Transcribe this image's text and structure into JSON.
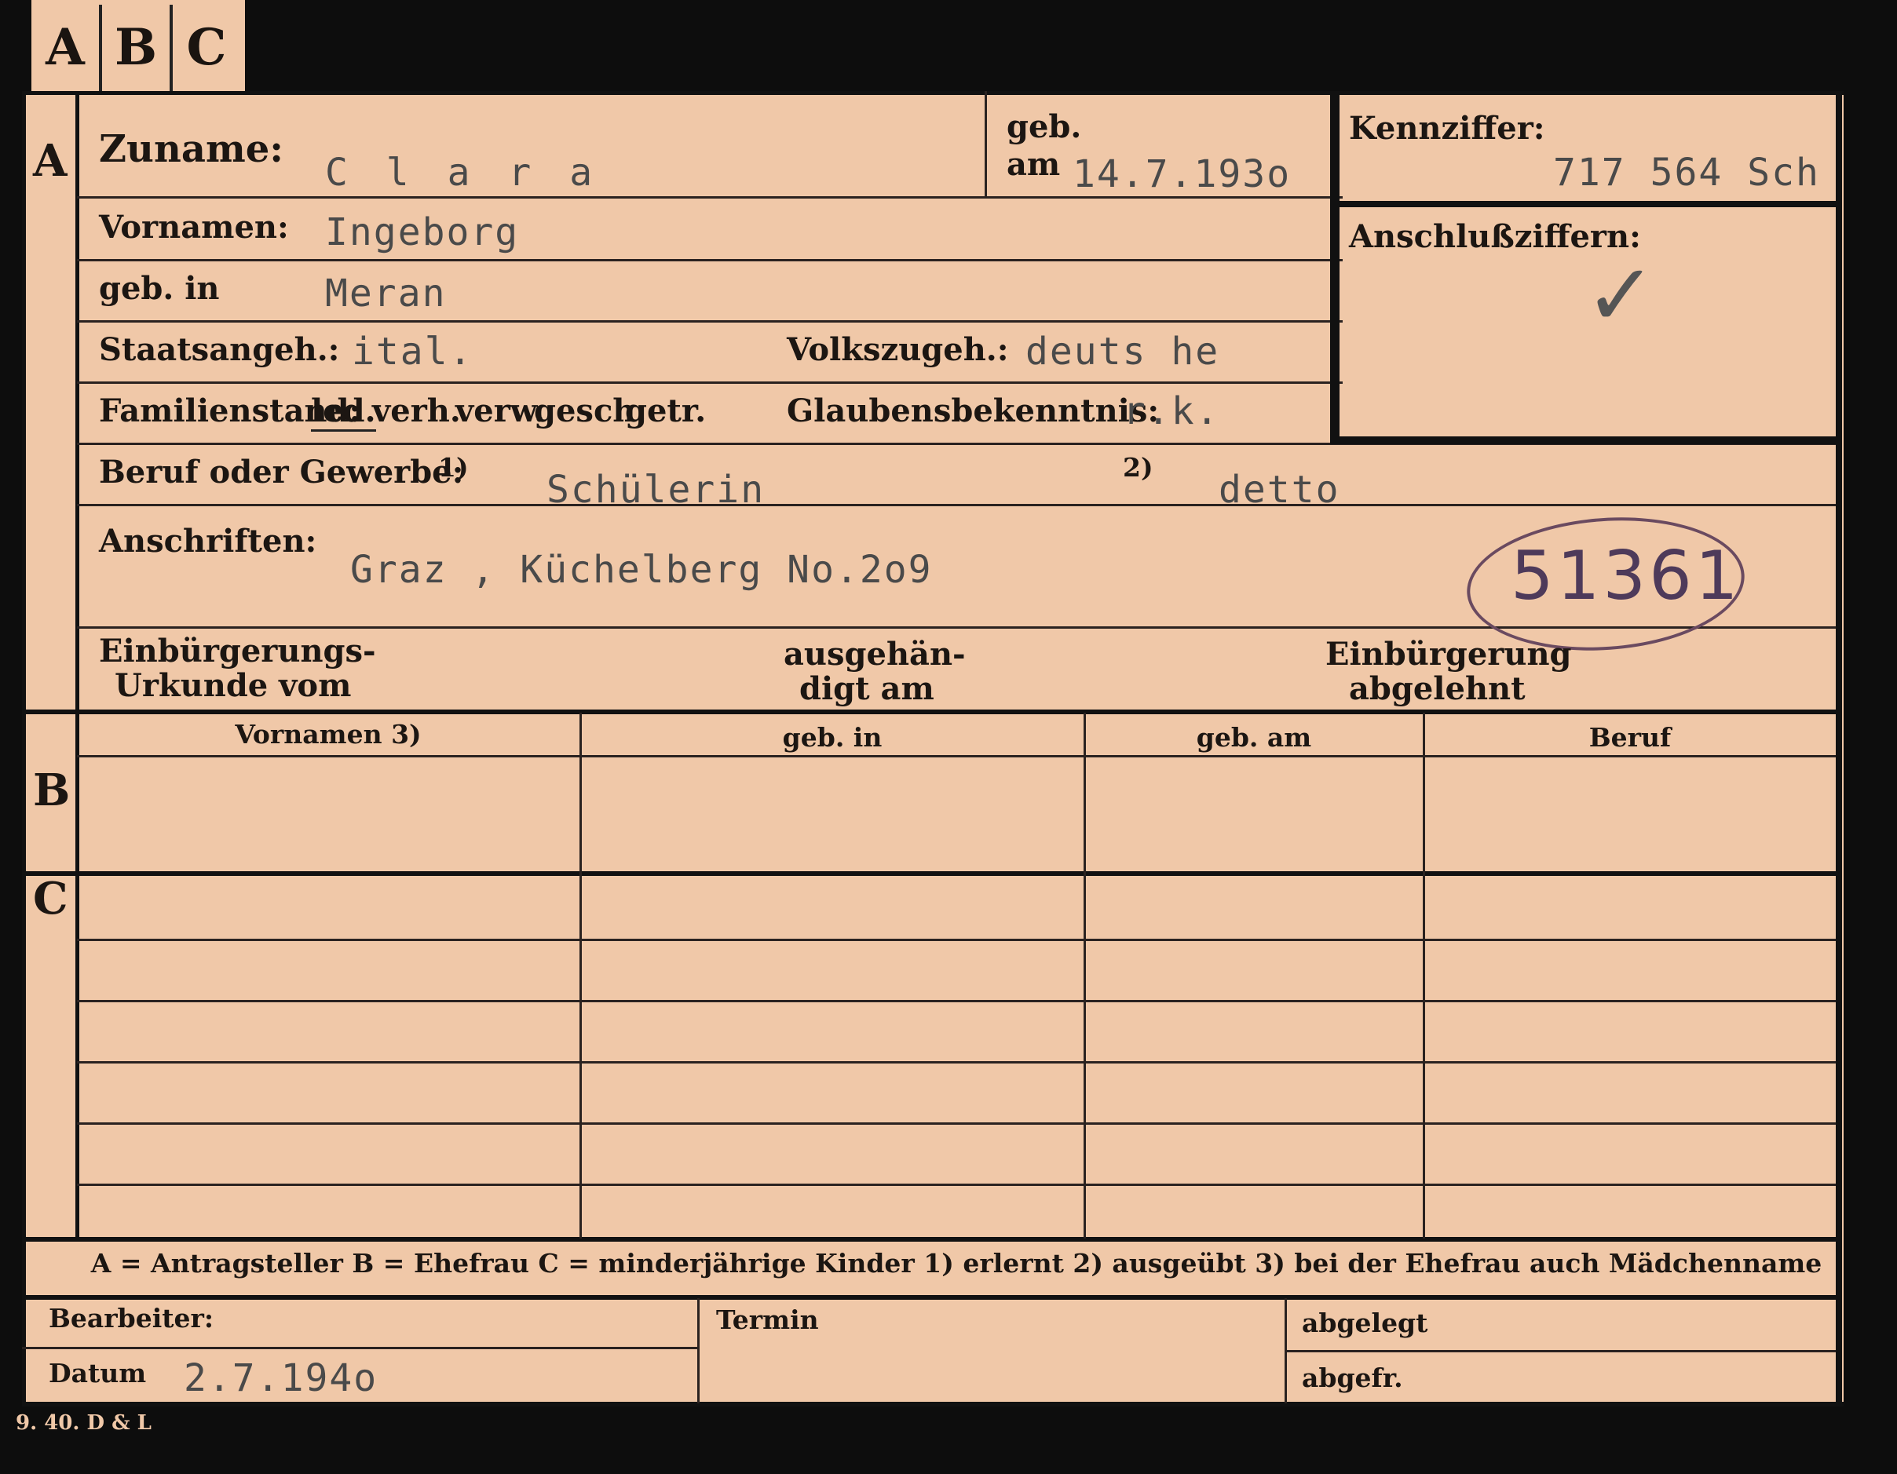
{
  "tabs": [
    "A",
    "B",
    "C"
  ],
  "sections": {
    "a": "A",
    "b": "B",
    "c": "C"
  },
  "section_a": {
    "zuname_label": "Zuname:",
    "zuname_value": "C l a r a",
    "geb_label": "geb.",
    "am_label": "am",
    "geb_am_value": "14.7.193o",
    "kennziffer_label": "Kennziffer:",
    "kennziffer_value": "717 564  Sch",
    "anschluss_label": "Anschlußziffern:",
    "anschluss_mark": "✓",
    "vornamen_label": "Vornamen:",
    "vornamen_value": "Ingeborg",
    "geb_in_label": "geb. in",
    "geb_in_value": "Meran",
    "staats_label": "Staatsangeh.:",
    "staats_value": "ital.",
    "volks_label": "Volkszugeh.:",
    "volks_value": "deuts he",
    "familien_label": "Familienstand:",
    "familien_options": [
      "led.",
      "verh.",
      "verw.",
      "gesch.",
      "getr."
    ],
    "glauben_label": "Glaubensbekenntnis:",
    "glauben_value": "r.k.",
    "beruf_label": "Beruf oder Gewerbe:",
    "beruf_note1": "1)",
    "beruf_value1": "Schülerin",
    "beruf_note2": "2)",
    "beruf_value2": "detto",
    "anschriften_label": "Anschriften:",
    "anschriften_value": "Graz , Küchelberg No.2o9",
    "stamp_number": "51361",
    "einb_urkunde_line1": "Einbürgerungs-",
    "einb_urkunde_line2": "Urkunde vom",
    "ausgehaen_line1": "ausgehän-",
    "ausgehaen_line2": "digt am",
    "einb_abgelehnt_line1": "Einbürgerung",
    "einb_abgelehnt_line2": "abgelehnt"
  },
  "table_headers": [
    "Vornamen 3)",
    "geb. in",
    "geb. am",
    "Beruf"
  ],
  "legend": "A = Antragsteller   B = Ehefrau   C = minderjährige Kinder   1) erlernt   2) ausgeübt   3) bei der Ehefrau auch Mädchenname",
  "footer": {
    "bearbeiter_label": "Bearbeiter:",
    "datum_label": "Datum",
    "datum_value": "2.7.194o",
    "termin_label": "Termin",
    "abgelegt_label": "abgelegt",
    "abgefr_label": "abgefr."
  },
  "print_code": "9. 40. D & L"
}
